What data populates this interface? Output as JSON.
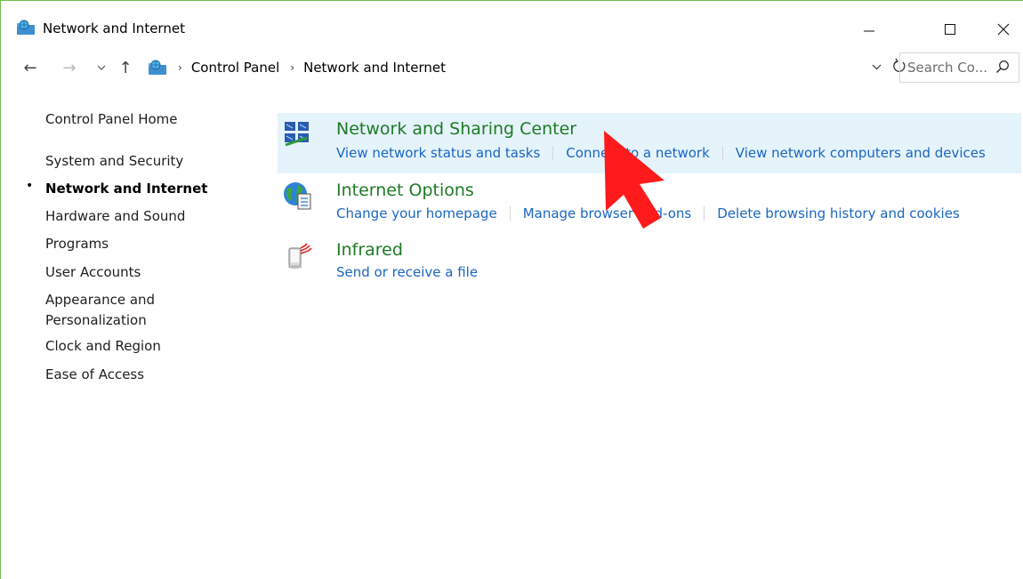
{
  "window": {
    "title": "Network and Internet",
    "controls": {
      "minimize": "–",
      "maximize": "☐",
      "close": "✕"
    }
  },
  "toolbar": {
    "back": "←",
    "forward": "→",
    "recent": "⌵",
    "up": "↑"
  },
  "address": {
    "crumbs": [
      "Control Panel",
      "Network and Internet"
    ],
    "separator": "›",
    "dropdown": "⌵",
    "refresh": "↻"
  },
  "search": {
    "placeholder": "Search Co..."
  },
  "leftnav": {
    "items": [
      {
        "label": "Control Panel Home"
      },
      {
        "label": "System and Security"
      },
      {
        "label": "Network and Internet",
        "active": true
      },
      {
        "label": "Hardware and Sound"
      },
      {
        "label": "Programs"
      },
      {
        "label": "User Accounts"
      },
      {
        "label": "Appearance and"
      },
      {
        "label": "Personalization"
      },
      {
        "label": "Clock and Region"
      },
      {
        "label": "Ease of Access"
      }
    ],
    "bullet": "•"
  },
  "categories": [
    {
      "icon": "network-sharing-icon",
      "title": "Network and Sharing Center",
      "links": [
        "View network status and tasks",
        "Connect to a network",
        "View network computers and devices"
      ]
    },
    {
      "icon": "internet-options-icon",
      "title": "Internet Options",
      "links": [
        "Change your homepage",
        "Manage browser add-ons",
        "Delete browsing history and cookies"
      ]
    },
    {
      "icon": "infrared-icon",
      "title": "Infrared",
      "links": [
        "Send or receive a file"
      ]
    }
  ],
  "colors": {
    "accent_green": "#1e7a25",
    "link_blue": "#1a66c2",
    "highlight": "#e5f3fb",
    "window_border": "#6fbf4a",
    "pointer_red": "#ff1b1b"
  }
}
